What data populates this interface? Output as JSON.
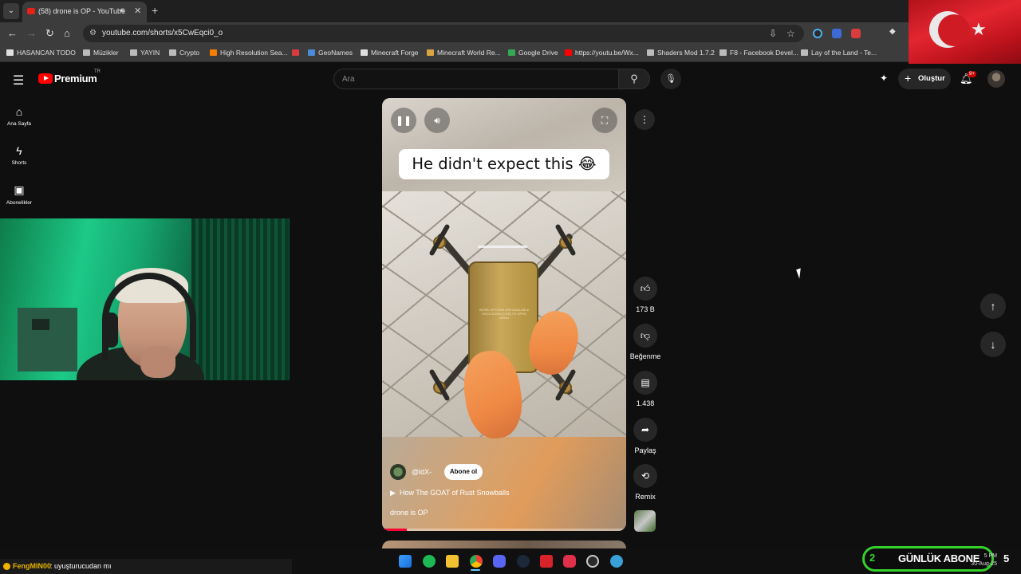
{
  "browser": {
    "tab": {
      "title": "(58) drone is OP - YouTube",
      "audio_icon": "speaker-icon",
      "close": "✕"
    },
    "new_tab": "+",
    "url": "youtube.com/shorts/x5CwEqci0_o",
    "bookmarks": [
      {
        "label": "HASANCAN TODO",
        "icon": "page-icon",
        "color": "#e0e0e0"
      },
      {
        "label": "Müzikler",
        "icon": "folder-icon",
        "color": "#bbbbbb"
      },
      {
        "label": "YAYIN",
        "icon": "folder-icon",
        "color": "#bbbbbb"
      },
      {
        "label": "Crypto",
        "icon": "folder-icon",
        "color": "#bbbbbb"
      },
      {
        "label": "High Resolution Sea...",
        "icon": "blogger-icon",
        "color": "#f57d00"
      },
      {
        "label": "",
        "icon": "x-icon",
        "color": "#d83c3c"
      },
      {
        "label": "GeoNames",
        "icon": "globe-icon",
        "color": "#4a8ad8"
      },
      {
        "label": "Minecraft Forge",
        "icon": "anvil-icon",
        "color": "#dddddd"
      },
      {
        "label": "Minecraft World Re...",
        "icon": "person-icon",
        "color": "#d9a441"
      },
      {
        "label": "Google Drive",
        "icon": "drive-icon",
        "color": "#34a853"
      },
      {
        "label": "https://youtu.be/Wx...",
        "icon": "youtube-icon",
        "color": "#ff0000"
      },
      {
        "label": "Shaders Mod 1.7.2",
        "icon": "globe-icon",
        "color": "#bbbbbb"
      },
      {
        "label": "F8 - Facebook Devel...",
        "icon": "globe-icon",
        "color": "#bbbbbb"
      },
      {
        "label": "Lay of the Land - Te...",
        "icon": "globe-icon",
        "color": "#bbbbbb"
      }
    ]
  },
  "header": {
    "logo_text": "Premium",
    "logo_region": "TR",
    "search_placeholder": "Ara",
    "create_label": "Oluştur",
    "notification_count": "9+"
  },
  "sidebar": [
    {
      "label": "Ana Sayfa",
      "icon": "home-icon"
    },
    {
      "label": "Shorts",
      "icon": "shorts-icon"
    },
    {
      "label": "Abonelikler",
      "icon": "subscriptions-icon"
    }
  ],
  "short": {
    "caption": "He didn't expect this 😂",
    "channel": "@ldX-",
    "subscribe_label": "Abone ol",
    "reference": "How The GOAT of Rust Snowballs",
    "description": "drone is OP",
    "progress": 0.1,
    "drone_text": "WORK OPTIONS ARE AVAILABLE HOLD DOWN [USE] TO OPEN MENU"
  },
  "actions": {
    "likes": "173 B",
    "dislike_label": "Beğenme",
    "comments": "1.438",
    "share_label": "Paylaş",
    "remix_label": "Remix"
  },
  "chat": {
    "user": "FengMIN00",
    "message": ": uyuşturucudan mı"
  },
  "overlay": {
    "number": "2",
    "label": "GÜNLÜK ABONE"
  },
  "tray": {
    "time": "5 PM",
    "date": "30-Aug-25",
    "number": "5"
  },
  "colors": {
    "accent": "#ff0000",
    "overlay_green": "#34d12b",
    "chat_user": "#e8b400"
  }
}
